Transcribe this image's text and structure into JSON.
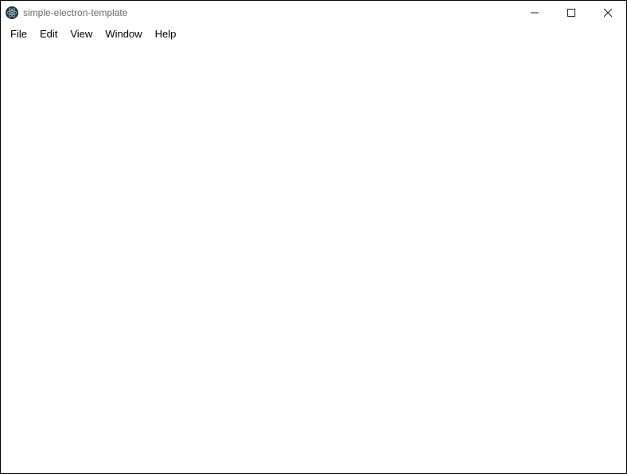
{
  "window": {
    "title": "simple-electron-template"
  },
  "menubar": {
    "items": [
      "File",
      "Edit",
      "View",
      "Window",
      "Help"
    ]
  }
}
